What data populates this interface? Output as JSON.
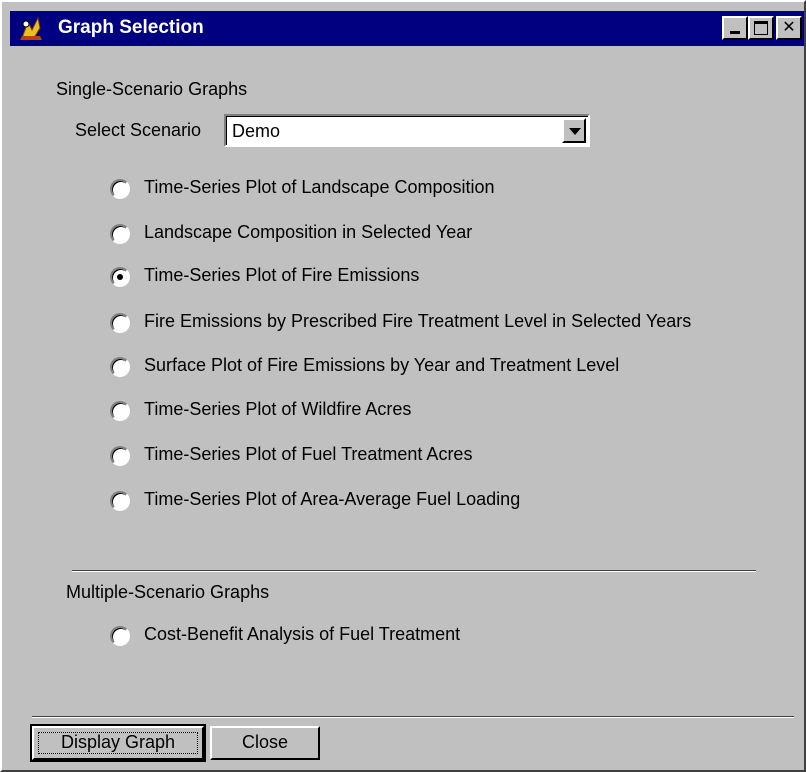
{
  "window": {
    "title": "Graph Selection",
    "icon": "app-icon"
  },
  "single": {
    "heading": "Single-Scenario Graphs",
    "select_label": "Select Scenario",
    "select_value": "Demo",
    "options": [
      {
        "label": "Time-Series Plot of Landscape Composition",
        "checked": false
      },
      {
        "label": "Landscape Composition in Selected Year",
        "checked": false
      },
      {
        "label": "Time-Series Plot of Fire Emissions",
        "checked": true
      },
      {
        "label": "Fire Emissions by Prescribed Fire Treatment Level in Selected Years",
        "checked": false
      },
      {
        "label": "Surface Plot of Fire Emissions by Year and Treatment Level",
        "checked": false
      },
      {
        "label": "Time-Series Plot of Wildfire Acres",
        "checked": false
      },
      {
        "label": "Time-Series Plot of Fuel Treatment Acres",
        "checked": false
      },
      {
        "label": "Time-Series Plot of Area-Average Fuel Loading",
        "checked": false
      }
    ]
  },
  "multiple": {
    "heading": "Multiple-Scenario Graphs",
    "options": [
      {
        "label": "Cost-Benefit Analysis of Fuel Treatment",
        "checked": false
      }
    ]
  },
  "buttons": {
    "display_label": "Display Graph",
    "close_label": "Close"
  },
  "colors": {
    "titlebar": "#000080",
    "face": "#c0c0c0"
  }
}
